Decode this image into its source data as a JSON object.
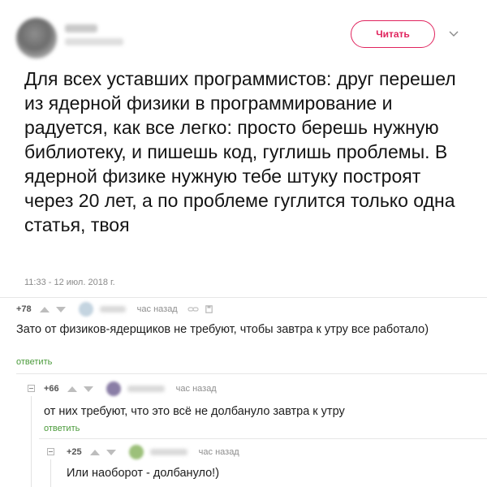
{
  "tweet": {
    "follow_label": "Читать",
    "text": "Для всех уставших программистов: друг перешел из ядерной физики в программирование и радуется, как все легко: просто берешь нужную библиотеку, и пишешь код, гуглишь проблемы. В ядерной физике нужную тебе штуку построят через 20 лет, а по проблеме гуглится только одна статья, твоя",
    "timestamp": "11:33 - 12 июл. 2018 г."
  },
  "comments": [
    {
      "score": "+78",
      "time": "час назад",
      "text": "Зато от физиков-ядерщиков не требуют, чтобы завтра к утру все работало)",
      "reply_label": "ответить",
      "avatar_color": "#c4d4e0"
    },
    {
      "score": "+66",
      "time": "час назад",
      "text": "от них требуют, что это всё не долбануло завтра к утру",
      "reply_label": "ответить",
      "avatar_color": "#8a7ea6"
    },
    {
      "score": "+25",
      "time": "час назад",
      "text": "Или наоборот - долбануло!)",
      "avatar_color": "#9cc07a"
    }
  ],
  "colors": {
    "follow": "#e0245e",
    "reply_link": "#4a9a3a"
  },
  "icons": [
    "chevron-down-icon",
    "upvote-icon",
    "downvote-icon",
    "link-icon",
    "save-icon",
    "collapse-icon"
  ]
}
